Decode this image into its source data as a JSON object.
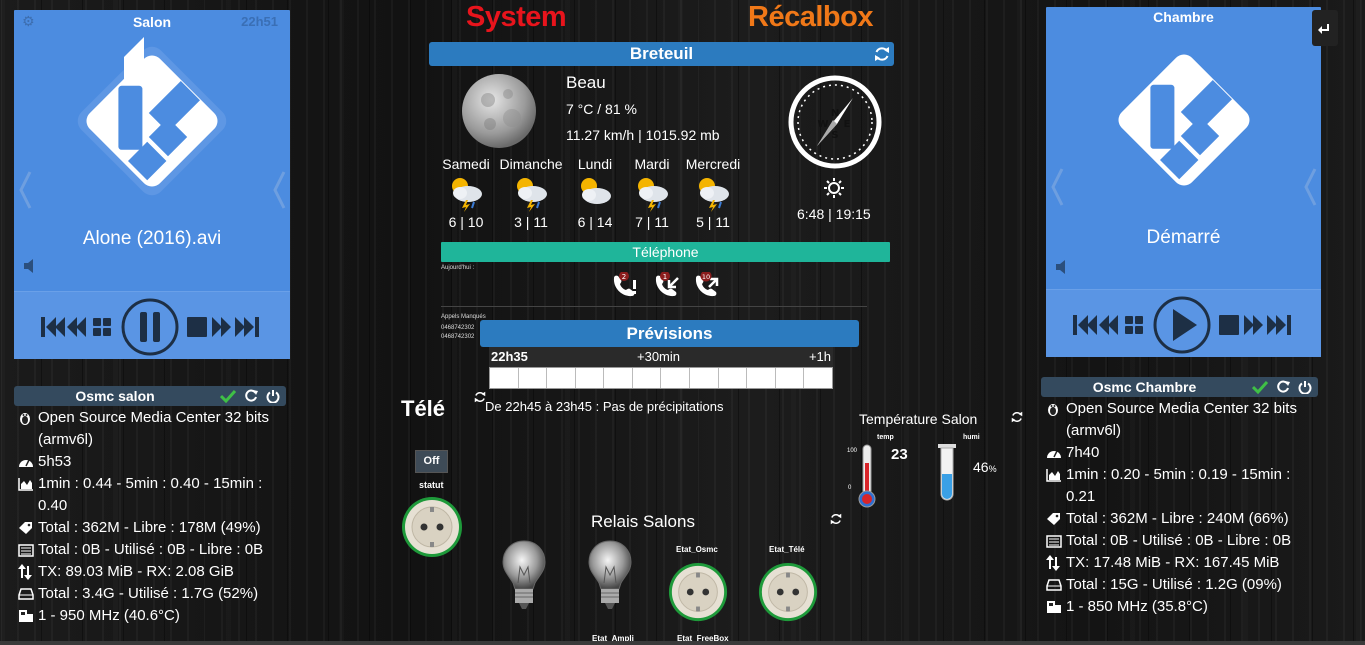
{
  "kodi_salon": {
    "title": "Salon",
    "time": "22h51",
    "media": "Alone (2016).avi"
  },
  "kodi_chambre": {
    "title": "Chambre",
    "media": "Démarré"
  },
  "osmc_salon": {
    "title": "Osmc salon",
    "lines": [
      "Open Source Media Center 32 bits (armv6l)",
      "5h53",
      "1min : 0.44 - 5min : 0.40 - 15min : 0.40",
      "Total : 362M - Libre : 178M (49%)",
      "Total : 0B - Utilisé : 0B - Libre : 0B",
      "TX: 89.03 MiB - RX: 2.08 GiB",
      "Total : 3.4G - Utilisé : 1.7G (52%)",
      "1 - 950 MHz (40.6°C)"
    ]
  },
  "osmc_chambre": {
    "title": "Osmc Chambre",
    "lines": [
      "Open Source Media Center 32 bits (armv6l)",
      "7h40",
      "1min : 0.20 - 5min : 0.19 - 15min : 0.21",
      "Total : 362M - Libre : 240M (66%)",
      "Total : 0B - Utilisé : 0B - Libre : 0B",
      "TX: 17.48 MiB - RX: 167.45 MiB",
      "Total : 15G - Utilisé : 1.2G (09%)",
      "1 - 850 MHz (35.8°C)"
    ]
  },
  "header": {
    "system": "System",
    "recalbox": "Récalbox",
    "system_color": "#e8141c",
    "recalbox_color": "#f07818"
  },
  "weather": {
    "city": "Breteuil",
    "condition": "Beau",
    "temp_hum": "7 °C / 81 %",
    "wind_pressure": "11.27 km/h | 1015.92 mb",
    "sun": "6:48 | 19:15",
    "days": [
      {
        "name": "Samedi",
        "temps": "6 | 10"
      },
      {
        "name": "Dimanche",
        "temps": "3 | 11"
      },
      {
        "name": "Lundi",
        "temps": "6 | 14"
      },
      {
        "name": "Mardi",
        "temps": "7 | 11"
      },
      {
        "name": "Mercredi",
        "temps": "5 | 11"
      }
    ]
  },
  "phone": {
    "title": "Téléphone",
    "today": "Aujourd'hui :",
    "missed_count": "2",
    "incoming_count": "1",
    "outgoing_count": "10",
    "missed_title": "Appels Manqués",
    "missed_1": "0468742302",
    "missed_2": "0468742302"
  },
  "previsions": {
    "title": "Prévisions",
    "t0": "22h35",
    "t1": "+30min",
    "t2": "+1h",
    "text": "De 22h45 à 23h45 : Pas de précipitations"
  },
  "tele": {
    "title": "Télé",
    "off": "Off",
    "statut": "statut"
  },
  "temperature": {
    "title": "Température Salon",
    "temp_label": "temp",
    "humi_label": "humi",
    "scale_top": "100",
    "scale_bottom": "0",
    "temp_value": "23",
    "humi_value": "46",
    "humi_unit": "%"
  },
  "relais": {
    "title": "Relais Salons",
    "etat_osmc": "Etat_Osmc",
    "etat_tele": "Etat_Télé",
    "etat_ampli": "Etat_Ampli",
    "etat_freebox": "Etat_FreeBox"
  },
  "icons": {
    "accent": "#2c7bbf",
    "teal": "#1fb59a",
    "check": "#3fc046"
  }
}
